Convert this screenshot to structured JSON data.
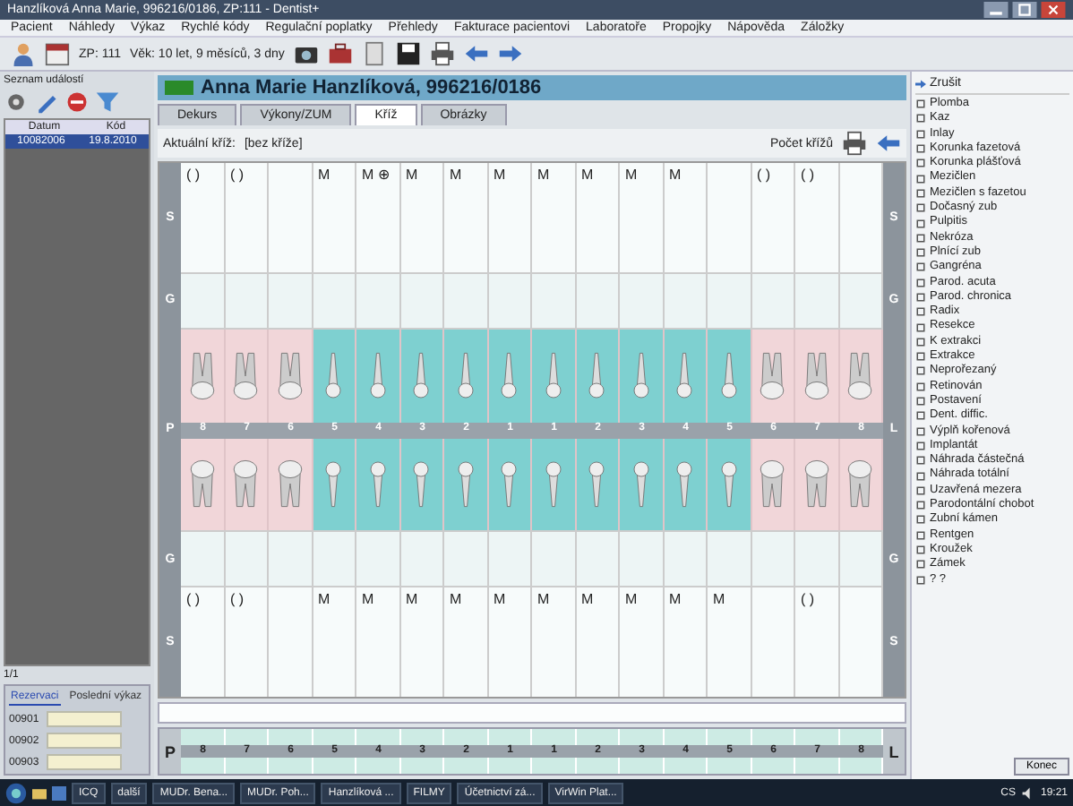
{
  "window": {
    "title": "Hanzlíková Anna Marie, 996216/0186, ZP:111 - Dentist+"
  },
  "menu": [
    "Pacient",
    "Náhledy",
    "Výkaz",
    "Rychlé kódy",
    "Regulační poplatky",
    "Přehledy",
    "Fakturace pacientovi",
    "Laboratoře",
    "Propojky",
    "Nápověda",
    "Záložky"
  ],
  "toolbar": {
    "insurer": "ZP: 111",
    "age": "Věk: 10 let, 9 měsíců, 3 dny",
    "caption": "Seznam událostí"
  },
  "events": {
    "columns": [
      "Datum",
      "Kód"
    ],
    "rows": [
      {
        "cells": [
          "10082006",
          "19.8.2010"
        ],
        "selected": true
      }
    ],
    "pager": "1/1",
    "tabs": [
      {
        "label": "Rezervaci",
        "selected": true
      },
      {
        "label": "Poslední výkaz",
        "selected": false
      }
    ],
    "codes": [
      "00901",
      "00902",
      "00903"
    ]
  },
  "patient": {
    "name": "Anna Marie Hanzlíková, 996216/0186"
  },
  "tabs": [
    {
      "label": "Dekurs",
      "selected": false
    },
    {
      "label": "Výkony/ZUM",
      "selected": false
    },
    {
      "label": "Kříž",
      "selected": true
    },
    {
      "label": "Obrázky",
      "selected": false
    }
  ],
  "cross": {
    "current_label": "Aktuální kříž:",
    "current_value": "[bez kříže]",
    "count_label": "Počet křížů"
  },
  "chart": {
    "left_labels": [
      "S",
      "G",
      "P",
      "G",
      "S"
    ],
    "right_labels": [
      "S",
      "G",
      "L",
      "G",
      "S"
    ],
    "teeth": [
      {
        "number": "8",
        "highlighted": false,
        "upper_mark": "( )",
        "lower_mark": "( )"
      },
      {
        "number": "7",
        "highlighted": false,
        "upper_mark": "( )",
        "lower_mark": "( )"
      },
      {
        "number": "6",
        "highlighted": false
      },
      {
        "number": "5",
        "highlighted": true,
        "upper_mark": "M",
        "lower_mark": "M"
      },
      {
        "number": "4",
        "highlighted": true,
        "upper_mark": "M ⊕",
        "lower_mark": "M"
      },
      {
        "number": "3",
        "highlighted": true,
        "upper_mark": "M",
        "lower_mark": "M"
      },
      {
        "number": "2",
        "highlighted": true,
        "upper_mark": "M",
        "lower_mark": "M"
      },
      {
        "number": "1",
        "highlighted": true,
        "upper_mark": "M",
        "lower_mark": "M"
      },
      {
        "number": "1",
        "highlighted": true,
        "upper_mark": "M",
        "lower_mark": "M"
      },
      {
        "number": "2",
        "highlighted": true,
        "upper_mark": "M",
        "lower_mark": "M"
      },
      {
        "number": "3",
        "highlighted": true,
        "upper_mark": "M",
        "lower_mark": "M"
      },
      {
        "number": "4",
        "highlighted": true,
        "upper_mark": "M",
        "lower_mark": "M"
      },
      {
        "number": "5",
        "highlighted": true,
        "lower_mark": "M"
      },
      {
        "number": "6",
        "highlighted": false,
        "upper_mark": "( )"
      },
      {
        "number": "7",
        "highlighted": false,
        "upper_mark": "( )",
        "lower_mark": "( )"
      },
      {
        "number": "8",
        "highlighted": false
      }
    ]
  },
  "summary": {
    "left_label": "P",
    "right_label": "L",
    "numbers": [
      "8",
      "7",
      "6",
      "5",
      "4",
      "3",
      "2",
      "1",
      "1",
      "2",
      "3",
      "4",
      "5",
      "6",
      "7",
      "8"
    ]
  },
  "findings": {
    "header": "Zrušit",
    "items": [
      "Plomba",
      "Kaz",
      "Inlay",
      "Korunka fazetová",
      "Korunka plášťová",
      "Mezičlen",
      "Mezičlen s fazetou",
      "Dočasný zub",
      "Pulpitis",
      "Nekróza",
      "Plnící zub",
      "Gangréna",
      "Parod. acuta",
      "Parod. chronica",
      "Radix",
      "Resekce",
      "K extrakci",
      "Extrakce",
      "Neprořezaný",
      "Retinován",
      "Postavení",
      "Dent. diffic.",
      "Výplň kořenová",
      "Implantát",
      "Náhrada částečná",
      "Náhrada totální",
      "Uzavřená mezera",
      "Parodontální chobot",
      "Zubní kámen",
      "Rentgen",
      "Kroužek",
      "Zámek",
      "? ?"
    ],
    "button": "Konec"
  },
  "taskbar": {
    "tasks": [
      "ICQ",
      "další",
      "MUDr. Bena...",
      "MUDr. Poh...",
      "Hanzlíková ...",
      "FILMY",
      "Účetnictví zá...",
      "VirWin Plat..."
    ],
    "language": "CS",
    "clock": "19:21"
  }
}
